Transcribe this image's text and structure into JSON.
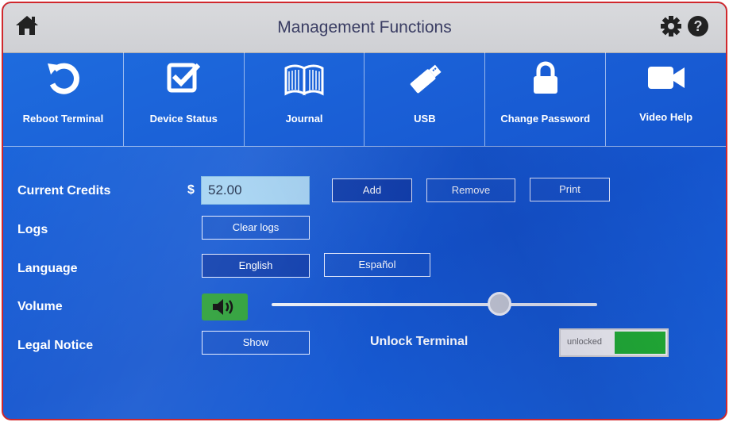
{
  "header": {
    "title": "Management Functions"
  },
  "toolbar": [
    {
      "label": "Reboot Terminal",
      "icon": "reboot-icon"
    },
    {
      "label": "Device Status",
      "icon": "checkbox-icon"
    },
    {
      "label": "Journal",
      "icon": "book-icon"
    },
    {
      "label": "USB",
      "icon": "usb-drive-icon"
    },
    {
      "label": "Change Password",
      "icon": "lock-icon"
    },
    {
      "label": "Video Help",
      "icon": "video-camera-icon"
    }
  ],
  "credits": {
    "label": "Current Credits",
    "currency": "$",
    "value": "52.00",
    "add_label": "Add",
    "remove_label": "Remove",
    "print_label": "Print"
  },
  "logs": {
    "label": "Logs",
    "clear_label": "Clear logs"
  },
  "language": {
    "label": "Language",
    "options": [
      "English",
      "Español"
    ],
    "selected": "English"
  },
  "volume": {
    "label": "Volume",
    "level": 0.7
  },
  "legal": {
    "label": "Legal Notice",
    "show_label": "Show"
  },
  "unlock": {
    "label": "Unlock Terminal",
    "state_text": "unlocked"
  },
  "colors": {
    "background": "#1a5fd6",
    "header": "#d4d5d9",
    "toggle_on": "#22b032",
    "volume_button": "#2ea03a",
    "frame_border": "#d0282c"
  }
}
